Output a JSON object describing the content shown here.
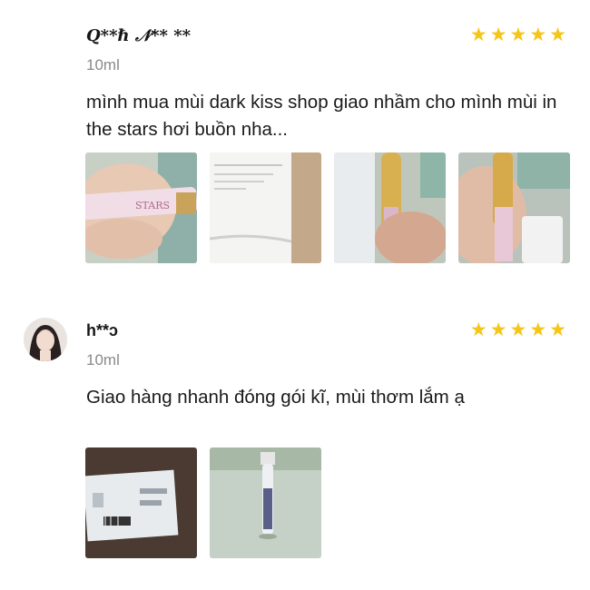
{
  "reviews": [
    {
      "username": "Q**ℏ 𝒩** **",
      "rating": 5,
      "variant": "10ml",
      "text": "mình mua mùi dark kiss shop giao nhầm cho mình mùi in the stars hơi buồn nha...",
      "photo_count": 4,
      "photo_1_label": "STARS"
    },
    {
      "username": "h**ɔ",
      "rating": 5,
      "variant": "10ml",
      "text": "Giao hàng nhanh đóng gói kĩ, mùi thơm lắm ạ",
      "photo_count": 2
    }
  ],
  "colors": {
    "star": "#f5c518",
    "variant": "#8a8a8a"
  },
  "star_icon": "star-icon"
}
